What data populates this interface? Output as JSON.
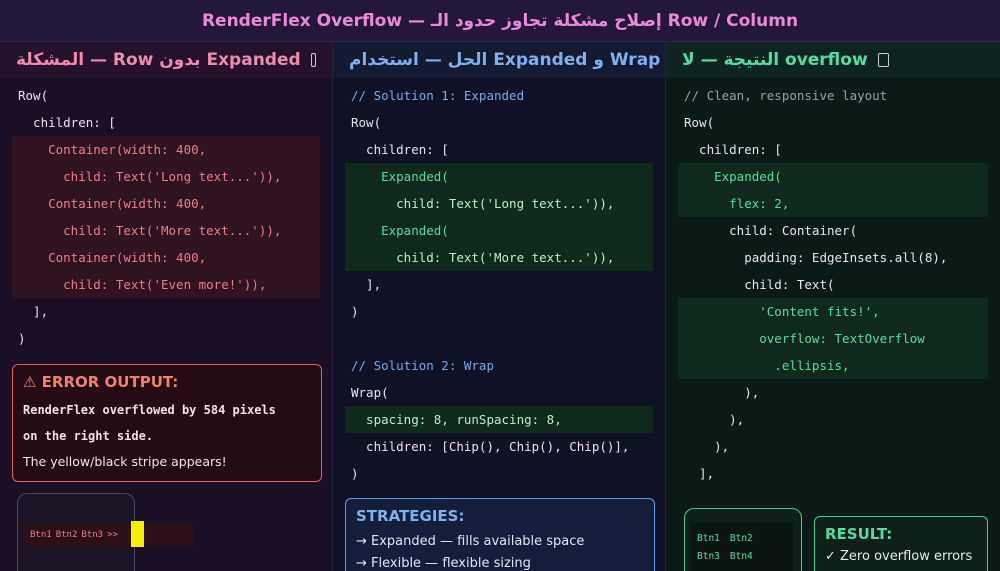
{
  "banner": {
    "title": "RenderFlex Overflow  —  إصلاح مشكلة تجاوز حدود الـ Row / Column"
  },
  "col1": {
    "header": "المشكلة — Row بدون Expanded",
    "code": [
      "Row(",
      "  children: [",
      "    Container(width: 400,",
      "      child: Text('Long text...')),",
      "    Container(width: 400,",
      "      child: Text('More text...')),",
      "    Container(width: 400,",
      "      child: Text('Even more!')),",
      "  ],",
      ")"
    ],
    "error": {
      "title": "⚠ ERROR OUTPUT:",
      "line1": "RenderFlex overflowed by 584 pixels",
      "line2": "on the right side.",
      "line3": "The yellow/black stripe appears!"
    },
    "phone_buttons": [
      "Btn1",
      "Btn2",
      "Btn3",
      ">>"
    ]
  },
  "col2": {
    "header": "الحل — استخدام Expanded و Wrap",
    "code": [
      "// Solution 1: Expanded",
      "Row(",
      "  children: [",
      "    Expanded(",
      "      child: Text('Long text...')),",
      "    Expanded(",
      "      child: Text('More text...')),",
      "  ],",
      ")",
      "",
      "// Solution 2: Wrap",
      "Wrap(",
      "  spacing: 8, runSpacing: 8,",
      "  children: [Chip(), Chip(), Chip()],",
      ")"
    ],
    "strategies": {
      "title": "STRATEGIES:",
      "line1": "→  Expanded  — fills available space",
      "line2": "→  Flexible  — flexible sizing"
    }
  },
  "col3": {
    "header": "النتيجة — لا overflow",
    "code": [
      "// Clean, responsive layout",
      "Row(",
      "  children: [",
      "    Expanded(",
      "      flex: 2,",
      "      child: Container(",
      "        padding: EdgeInsets.all(8),",
      "        child: Text(",
      "          'Content fits!',",
      "          overflow: TextOverflow",
      "            .ellipsis,",
      "        ),",
      "      ),",
      "    ),",
      "  ],"
    ],
    "phone_buttons": [
      "Btn1",
      "Btn2",
      "Btn3",
      "Btn4"
    ],
    "result": {
      "title": "RESULT:",
      "line1": "✓  Zero overflow errors"
    }
  },
  "colors": {
    "error": "#e06060",
    "success": "#3fd090",
    "info": "#5a9ae8",
    "stripe": "#f4f000"
  }
}
